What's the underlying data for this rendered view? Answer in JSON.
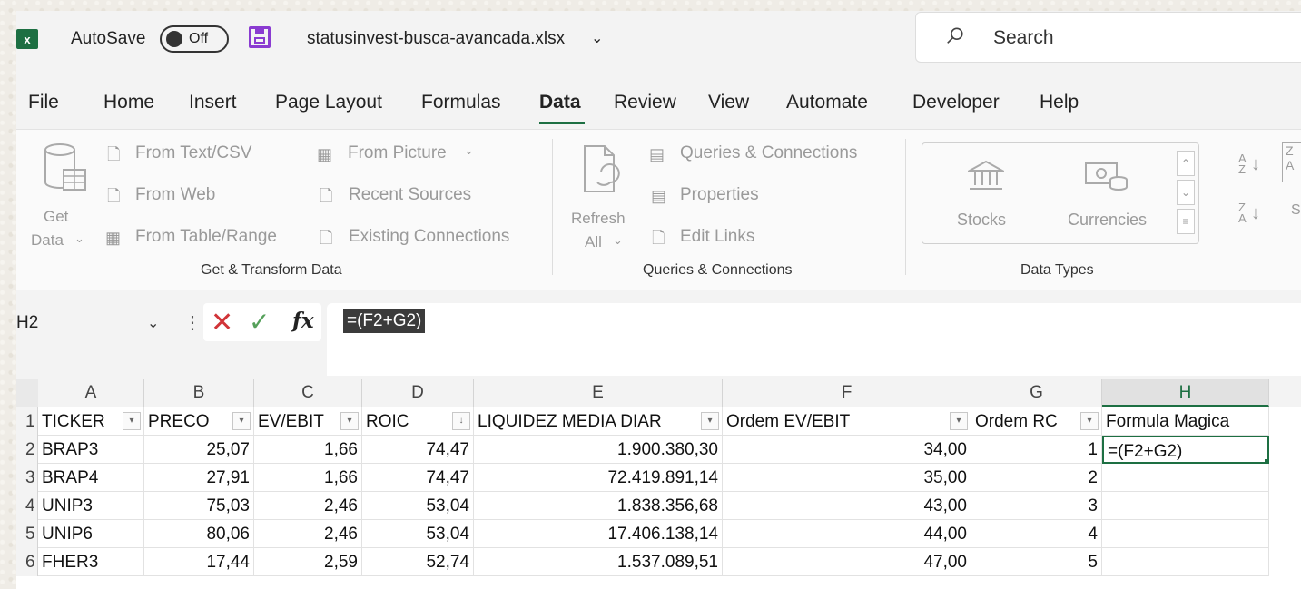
{
  "titlebar": {
    "autosave_label": "AutoSave",
    "autosave_state": "Off",
    "filename": "statusinvest-busca-avancada.xlsx",
    "search_placeholder": "Search"
  },
  "menu": {
    "tabs": [
      "File",
      "Home",
      "Insert",
      "Page Layout",
      "Formulas",
      "Data",
      "Review",
      "View",
      "Automate",
      "Developer",
      "Help"
    ],
    "active_tab": "Data"
  },
  "ribbon": {
    "get_transform": {
      "get_data_1": "Get",
      "get_data_2": "Data",
      "from_text_csv": "From Text/CSV",
      "from_web": "From Web",
      "from_table_range": "From Table/Range",
      "from_picture": "From Picture",
      "recent_sources": "Recent Sources",
      "existing_connections": "Existing Connections",
      "group_label": "Get & Transform Data"
    },
    "queries": {
      "refresh_all_1": "Refresh",
      "refresh_all_2": "All",
      "queries_connections": "Queries & Connections",
      "properties": "Properties",
      "edit_links": "Edit Links",
      "group_label": "Queries & Connections"
    },
    "data_types": {
      "stocks": "Stocks",
      "currencies": "Currencies",
      "group_label": "Data Types"
    },
    "sort": {
      "sort_label": "S"
    }
  },
  "formula_bar": {
    "name_box": "H2",
    "formula": "=(F2+G2)"
  },
  "sheet": {
    "columns": [
      "A",
      "B",
      "C",
      "D",
      "E",
      "F",
      "G",
      "H"
    ],
    "active_column": "H",
    "row_numbers": [
      "1",
      "2",
      "3",
      "4",
      "5",
      "6"
    ],
    "headers": [
      "TICKER",
      "PRECO",
      "EV/EBIT",
      "ROIC",
      "LIQUIDEZ MEDIA DIAR",
      "Ordem EV/EBIT",
      "Ordem RC",
      "Formula Magica"
    ],
    "rows": [
      [
        "BRAP3",
        "25,07",
        "1,66",
        "74,47",
        "1.900.380,30",
        "34,00",
        "1",
        "=(F2+G2)"
      ],
      [
        "BRAP4",
        "27,91",
        "1,66",
        "74,47",
        "72.419.891,14",
        "35,00",
        "2",
        ""
      ],
      [
        "UNIP3",
        "75,03",
        "2,46",
        "53,04",
        "1.838.356,68",
        "43,00",
        "3",
        ""
      ],
      [
        "UNIP6",
        "80,06",
        "2,46",
        "53,04",
        "17.406.138,14",
        "44,00",
        "4",
        ""
      ],
      [
        "FHER3",
        "17,44",
        "2,59",
        "52,74",
        "1.537.089,51",
        "47,00",
        "5",
        ""
      ]
    ]
  }
}
